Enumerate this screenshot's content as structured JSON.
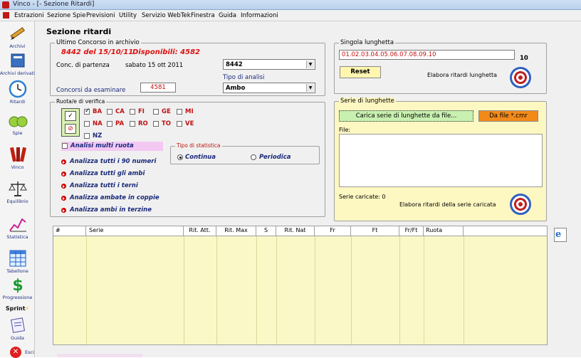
{
  "window": {
    "title": "Vinco - [- Sezione Ritardi]"
  },
  "menu": [
    "Estrazioni",
    "Sezione Spie",
    "Previsioni",
    "Utility",
    "Servizio WebTek",
    "Finestra",
    "Guida",
    "Informazioni"
  ],
  "sidebar": {
    "items": [
      {
        "label": "Archivi",
        "icon": "pencil-icon"
      },
      {
        "label": "Archivi derivati",
        "icon": "book-icon"
      },
      {
        "label": "Ritardi",
        "icon": "clock-icon"
      },
      {
        "label": "Spie",
        "icon": "binoculars-icon"
      },
      {
        "label": "Vinco",
        "icon": "vinco-icon"
      },
      {
        "label": "Equilibrio",
        "icon": "scale-icon"
      },
      {
        "label": "Statistica",
        "icon": "chart-icon"
      },
      {
        "label": "Tabellone",
        "icon": "table-icon"
      },
      {
        "label": "Progressione",
        "icon": "dollar-icon"
      },
      {
        "label": "Sprint",
        "icon": "sprint-icon"
      },
      {
        "label": "Guida",
        "icon": "guide-icon"
      },
      {
        "label": "Esci",
        "icon": "exit-icon"
      }
    ]
  },
  "section": {
    "title": "Sezione ritardi"
  },
  "archivio": {
    "group_title": "Ultimo Concorso in archivio",
    "last": "8442 del 15/10/11",
    "disponibili": "Disponibili: 4582",
    "partenza_label": "Conc. di partenza",
    "partenza_date": "sabato 15 ott 2011",
    "partenza_value": "8442",
    "tipo_label": "Tipo di analisi",
    "tipo_value": "Ambo",
    "esaminare_label": "Concorsi da esaminare",
    "esaminare_value": "4581"
  },
  "ruote": {
    "group_title": "Ruota/e di verifica",
    "items": [
      {
        "label": "BA",
        "checked": true
      },
      {
        "label": "CA",
        "checked": false
      },
      {
        "label": "FI",
        "checked": false
      },
      {
        "label": "GE",
        "checked": false
      },
      {
        "label": "MI",
        "checked": false
      },
      {
        "label": "NA",
        "checked": false
      },
      {
        "label": "PA",
        "checked": false
      },
      {
        "label": "RO",
        "checked": false
      },
      {
        "label": "TO",
        "checked": false
      },
      {
        "label": "VE",
        "checked": false
      },
      {
        "label": "NZ",
        "checked": false
      }
    ],
    "multi_label": "Analisi multi ruota",
    "statistica_title": "Tipo di statistica",
    "stat_continua": "Continua",
    "stat_periodica": "Periodica",
    "actions": [
      "Analizza tutti i 90 numeri",
      "Analizza tutti gli ambi",
      "Analizza tutti i terni",
      "Analizza ambate in coppie",
      "Analizza ambi in terzine"
    ]
  },
  "singola": {
    "group_title": "Singola lunghetta",
    "value": "01.02.03.04.05.06.07.08.09.10",
    "count": "10",
    "reset": "Reset",
    "elabora": "Elabora ritardi lunghetta"
  },
  "serie": {
    "group_title": "Serie di lunghette",
    "carica": "Carica serie di lunghette da file...",
    "dafile": "Da file *.cmr",
    "file_label": "File:",
    "caricate": "Serie caricate: 0",
    "elabora": "Elabora ritardi della serie caricata"
  },
  "table": {
    "headers": [
      "#",
      "Serie",
      "Rit. Att.",
      "Rit. Max",
      "S",
      "Rit. Nat",
      "Fr",
      "Ft",
      "Fr/Ft",
      "Ruota"
    ]
  },
  "colors": {
    "accent_red": "#e01010",
    "grid_yellow": "#fbf8c7",
    "panel_yellow": "#fdf7c2",
    "button_green": "#c8f0b0",
    "button_orange": "#f28a1a"
  }
}
